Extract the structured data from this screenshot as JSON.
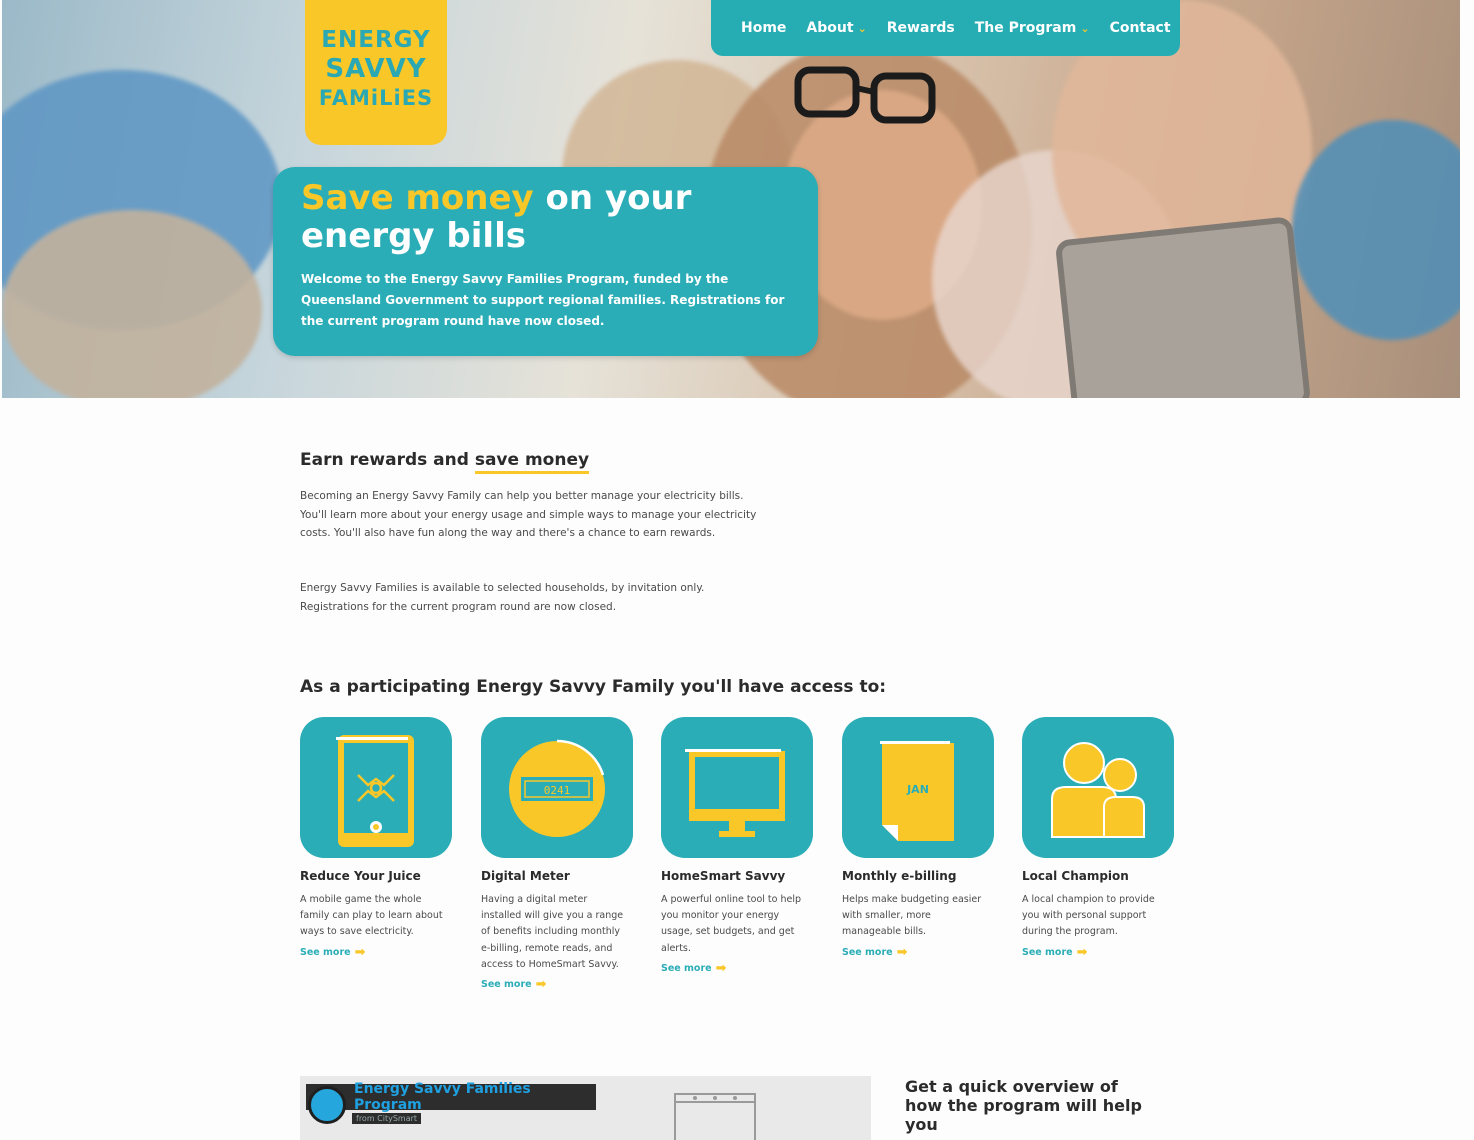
{
  "logo": {
    "line1": "ENERGY",
    "line2": "SAVVY",
    "line3": "FAMiLiES"
  },
  "nav": {
    "home": "Home",
    "about": "About",
    "rewards": "Rewards",
    "program": "The Program",
    "contact": "Contact"
  },
  "hero": {
    "headline_highlight": "Save money",
    "headline_rest": " on your energy bills",
    "intro": "Welcome to the Energy Savvy Families Program, funded by the Queensland Government to support regional families. Registrations for the current program round have now closed."
  },
  "rewards": {
    "title_plain": "Earn rewards and ",
    "title_underlined": "save money",
    "para1": "Becoming an Energy Savvy Family can help you better manage your electricity bills. You'll learn more about your energy usage and simple ways to manage your electricity costs. You'll also have fun along the way and there's a chance to earn rewards.",
    "para2": "Energy Savvy Families is available to selected households, by invitation only. Registrations for the current program round are now closed."
  },
  "access": {
    "title": "As a participating Energy Savvy Family you'll have access to:",
    "features": [
      {
        "name": "Reduce Your Juice",
        "desc": "A mobile game the whole family can play to learn about ways to save electricity.",
        "more": "See more",
        "icon": "mobile-game-icon"
      },
      {
        "name": "Digital Meter",
        "desc": "Having a digital meter installed will give you a range of benefits including monthly e-billing, remote reads, and access to HomeSmart Savvy.",
        "more": "See more",
        "icon": "digital-meter-icon"
      },
      {
        "name": "HomeSmart Savvy",
        "desc": "A powerful online tool to help you monitor your energy usage, set budgets, and get alerts.",
        "more": "See more",
        "icon": "monitor-icon"
      },
      {
        "name": "Monthly e-billing",
        "desc": "Helps make budgeting easier with smaller, more manageable bills.",
        "more": "See more",
        "icon": "calendar-bill-icon",
        "tile_text": "JAN"
      },
      {
        "name": "Local Champion",
        "desc": "A local champion to provide you with personal support during the program.",
        "more": "See more",
        "icon": "people-icon"
      }
    ]
  },
  "video": {
    "title": "Energy Savvy Families Program",
    "from": "from CitySmart"
  },
  "overview": {
    "text": "Get a quick overview of how the program will help you"
  },
  "colors": {
    "teal": "#2aadb6",
    "yellow": "#f9c728",
    "text": "#2b2b2b"
  }
}
